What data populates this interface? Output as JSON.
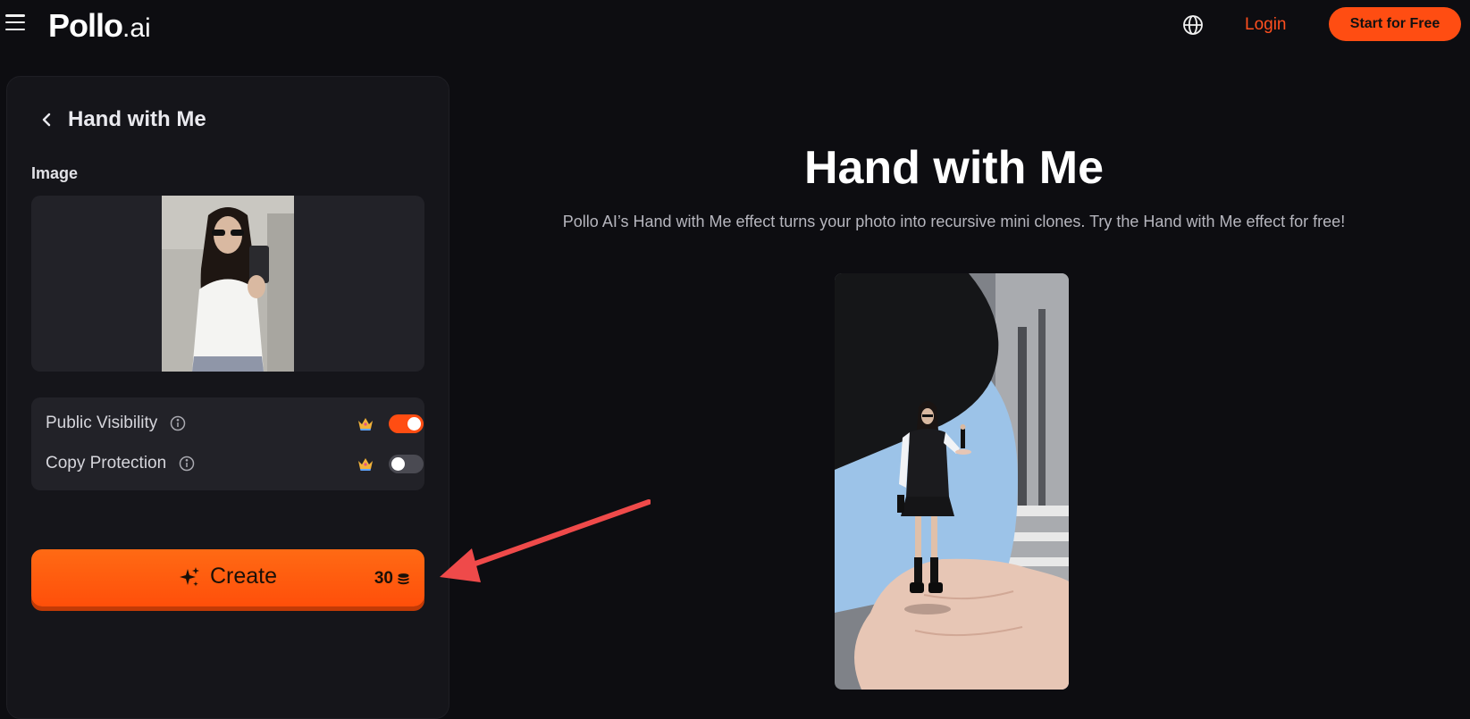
{
  "header": {
    "menu_icon": "hamburger-menu-icon",
    "logo_main": "Pollo",
    "logo_suffix": ".ai",
    "language_icon": "globe-icon",
    "login_label": "Login",
    "start_label": "Start for Free",
    "accent_color": "#ff4d12"
  },
  "sidebar": {
    "back_icon": "chevron-left-icon",
    "title": "Hand with Me",
    "image_label": "Image",
    "toggles": [
      {
        "label": "Public Visibility",
        "enabled": true
      },
      {
        "label": "Copy Protection",
        "enabled": false
      }
    ],
    "create_label": "Create",
    "credit_cost": "30"
  },
  "main": {
    "title": "Hand with Me",
    "description": "Pollo AI’s Hand with Me effect turns your photo into recursive mini clones. Try the Hand with Me effect for free!"
  }
}
